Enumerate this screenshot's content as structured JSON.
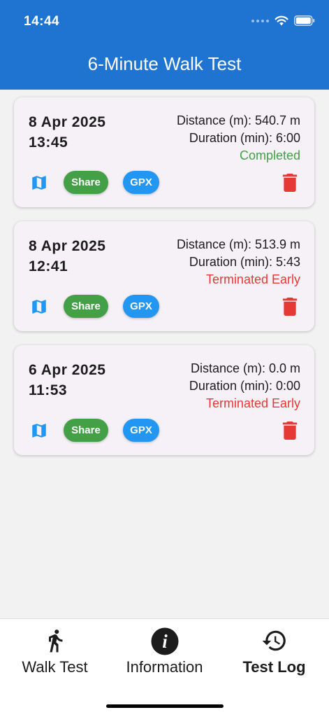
{
  "status_bar": {
    "time": "14:44"
  },
  "app_bar": {
    "title": "6-Minute Walk Test"
  },
  "tests": [
    {
      "date": "8 Apr 2025",
      "time": "13:45",
      "distance": "Distance (m): 540.7 m",
      "duration": "Duration (min): 6:00",
      "status": "Completed",
      "status_type": "completed",
      "share_label": "Share",
      "gpx_label": "GPX"
    },
    {
      "date": "8 Apr 2025",
      "time": "12:41",
      "distance": "Distance (m): 513.9 m",
      "duration": "Duration (min): 5:43",
      "status": "Terminated Early",
      "status_type": "early",
      "share_label": "Share",
      "gpx_label": "GPX"
    },
    {
      "date": "6 Apr 2025",
      "time": "11:53",
      "distance": "Distance (m): 0.0 m",
      "duration": "Duration (min): 0:00",
      "status": "Terminated Early",
      "status_type": "early",
      "share_label": "Share",
      "gpx_label": "GPX"
    }
  ],
  "bottom_nav": {
    "items": [
      {
        "label": "Walk Test",
        "icon": "walking-person-icon",
        "active": false
      },
      {
        "label": "Information",
        "icon": "info-icon",
        "active": false
      },
      {
        "label": "Test Log",
        "icon": "history-icon",
        "active": true
      }
    ]
  },
  "colors": {
    "primary": "#1f73d1",
    "completed": "#43a047",
    "terminated": "#e53935",
    "share": "#43a047",
    "gpx": "#2196f3",
    "map_icon": "#2196f3",
    "delete_icon": "#e53935"
  }
}
